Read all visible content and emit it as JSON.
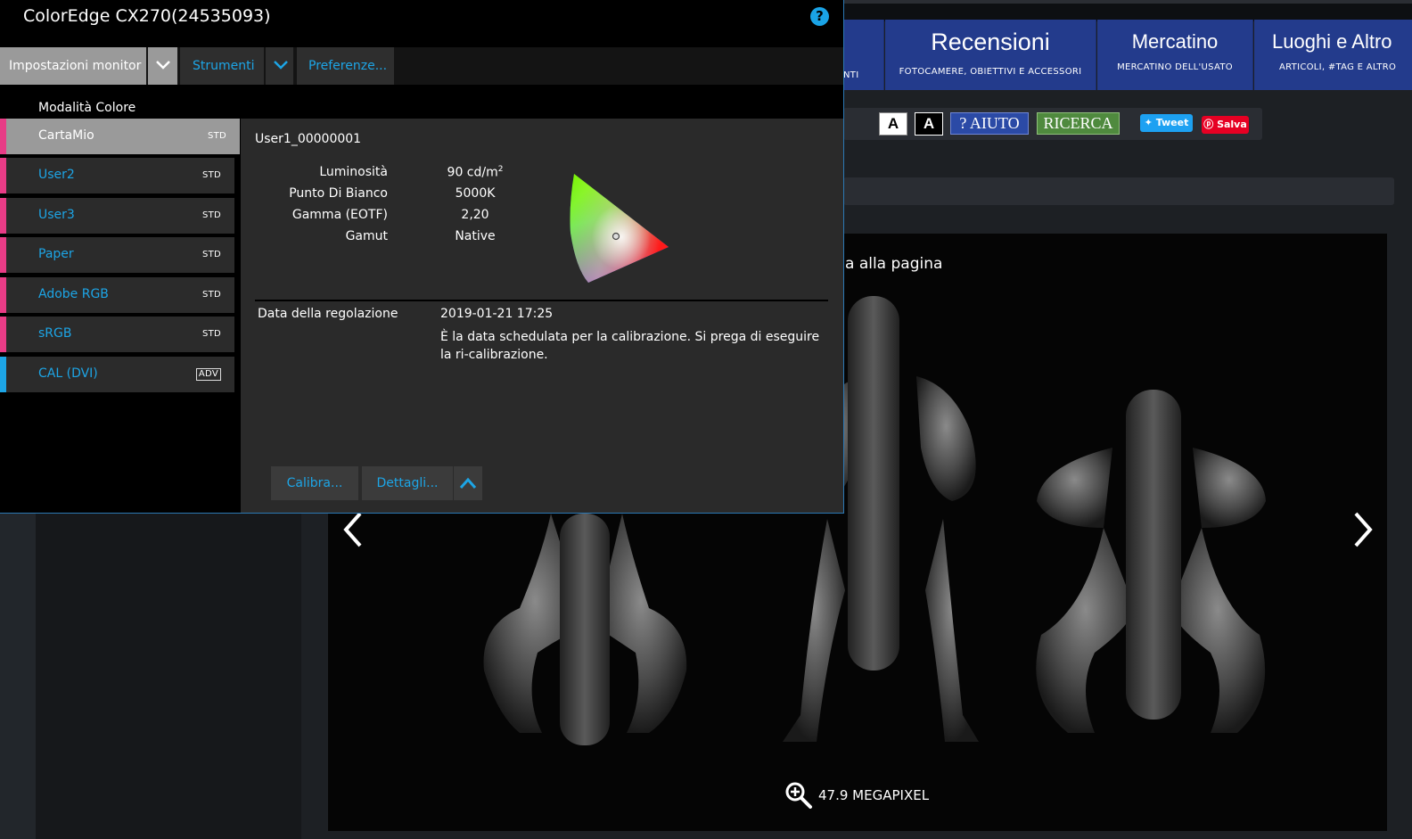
{
  "window": {
    "title": "ColorEdge CX270(24535093)"
  },
  "menu": {
    "impostazioni": "Impostazioni monitor",
    "strumenti": "Strumenti",
    "preferenze": "Preferenze..."
  },
  "color_mode": {
    "header": "Modalità Colore",
    "items": [
      {
        "name": "CartaMio",
        "badge": "STD"
      },
      {
        "name": "User2",
        "badge": "STD"
      },
      {
        "name": "User3",
        "badge": "STD"
      },
      {
        "name": "Paper",
        "badge": "STD"
      },
      {
        "name": "Adobe RGB",
        "badge": "STD"
      },
      {
        "name": "sRGB",
        "badge": "STD"
      },
      {
        "name": "CAL (DVI)",
        "badge": "ADV"
      }
    ]
  },
  "detail": {
    "mode_id": "User1_00000001",
    "luminosita_label": "Luminosità",
    "luminosita_value": "90 cd/m",
    "luminosita_sup": "2",
    "bianco_label": "Punto Di Bianco",
    "bianco_value": "5000K",
    "gamma_label": "Gamma (EOTF)",
    "gamma_value": "2,20",
    "gamut_label": "Gamut",
    "gamut_value": "Native",
    "date_label": "Data della regolazione",
    "date_value": "2019-01-21 17:25",
    "date_note": "È la data schedulata per la calibrazione. Si prega di eseguire la ri-calibrazione."
  },
  "buttons": {
    "calibra": "Calibra...",
    "dettagli": "Dettagli..."
  },
  "site": {
    "nav": [
      {
        "title": "",
        "subtitle": "NTI"
      },
      {
        "title": "Recensioni",
        "subtitle": "FOTOCAMERE, OBIETTIVI E ACCESSORI"
      },
      {
        "title": "Mercatino",
        "subtitle": "MERCATINO DELL'USATO"
      },
      {
        "title": "Luoghi e Altro",
        "subtitle": "ARTICOLI, #TAG E ALTRO"
      }
    ],
    "toolbar": {
      "a_light": "A",
      "a_dark": "A",
      "aiuto": "? AIUTO",
      "ricerca": "RICERCA",
      "tweet": "Tweet",
      "salva": "Salva"
    },
    "photo_caption": "a alla pagina",
    "megapixel": "47.9 MEGAPIXEL"
  },
  "colors": {
    "accent_blue": "#1da5e6",
    "mode_bar_pink": "#e83c86",
    "nav_blue": "#233b8c"
  }
}
